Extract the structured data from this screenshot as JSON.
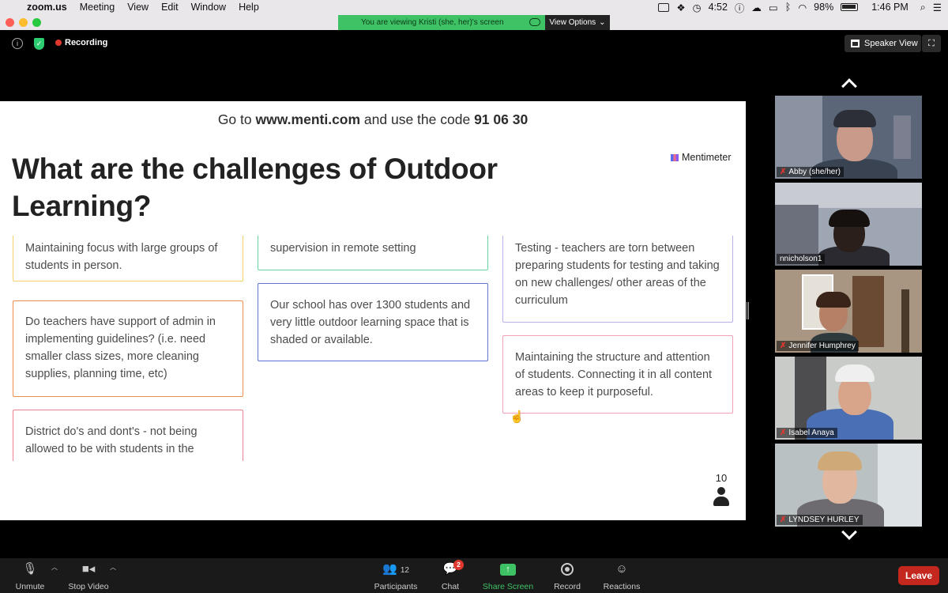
{
  "menubar": {
    "app": "zoom.us",
    "items": [
      "Meeting",
      "View",
      "Edit",
      "Window",
      "Help"
    ],
    "timer": "4:52",
    "battery": "98%",
    "time": "1:46 PM"
  },
  "banner": {
    "viewing_text": "You are viewing Kristi (she, her)'s screen",
    "view_options": "View Options"
  },
  "topbar": {
    "recording_label": "Recording",
    "speaker_view_label": "Speaker View"
  },
  "slide": {
    "header_pre": "Go to ",
    "header_url": "www.menti.com",
    "header_mid": " and use the code ",
    "header_code": "91 06 30",
    "brand": "Mentimeter",
    "question": "What are the challenges of Outdoor Learning?",
    "responses": {
      "col1": [
        "Maintaining focus with large groups of students in person.",
        "Do teachers have support of admin in implementing guidelines? (i.e. need smaller class sizes, more cleaning supplies, planning time, etc)",
        "District do's and dont's - not being allowed to be with students in the"
      ],
      "col2": [
        "supervision in remote setting",
        "Our school has over 1300 students and very little outdoor learning space that is shaded or available."
      ],
      "col3": [
        "Testing - teachers are torn between preparing students for testing and taking on new challenges/ other areas of the curriculum",
        "Maintaining the structure and attention of students. Connecting it in all content areas to keep it purposeful."
      ]
    },
    "participant_count": "10"
  },
  "gallery": {
    "participants": [
      {
        "name": "Abby (she/her)",
        "muted": true
      },
      {
        "name": "nnicholson1",
        "muted": false
      },
      {
        "name": "Jennifer Humphrey",
        "muted": true
      },
      {
        "name": "Isabel Anaya",
        "muted": true
      },
      {
        "name": "LYNDSEY HURLEY",
        "muted": true
      }
    ]
  },
  "toolbar": {
    "unmute": "Unmute",
    "stop_video": "Stop Video",
    "participants": "Participants",
    "participants_count": "12",
    "chat": "Chat",
    "chat_badge": "2",
    "share_screen": "Share Screen",
    "record": "Record",
    "reactions": "Reactions",
    "leave": "Leave"
  },
  "colors": {
    "share_green": "#3fc266",
    "leave_red": "#c4271d",
    "mentimeter_dark": "#222222"
  }
}
